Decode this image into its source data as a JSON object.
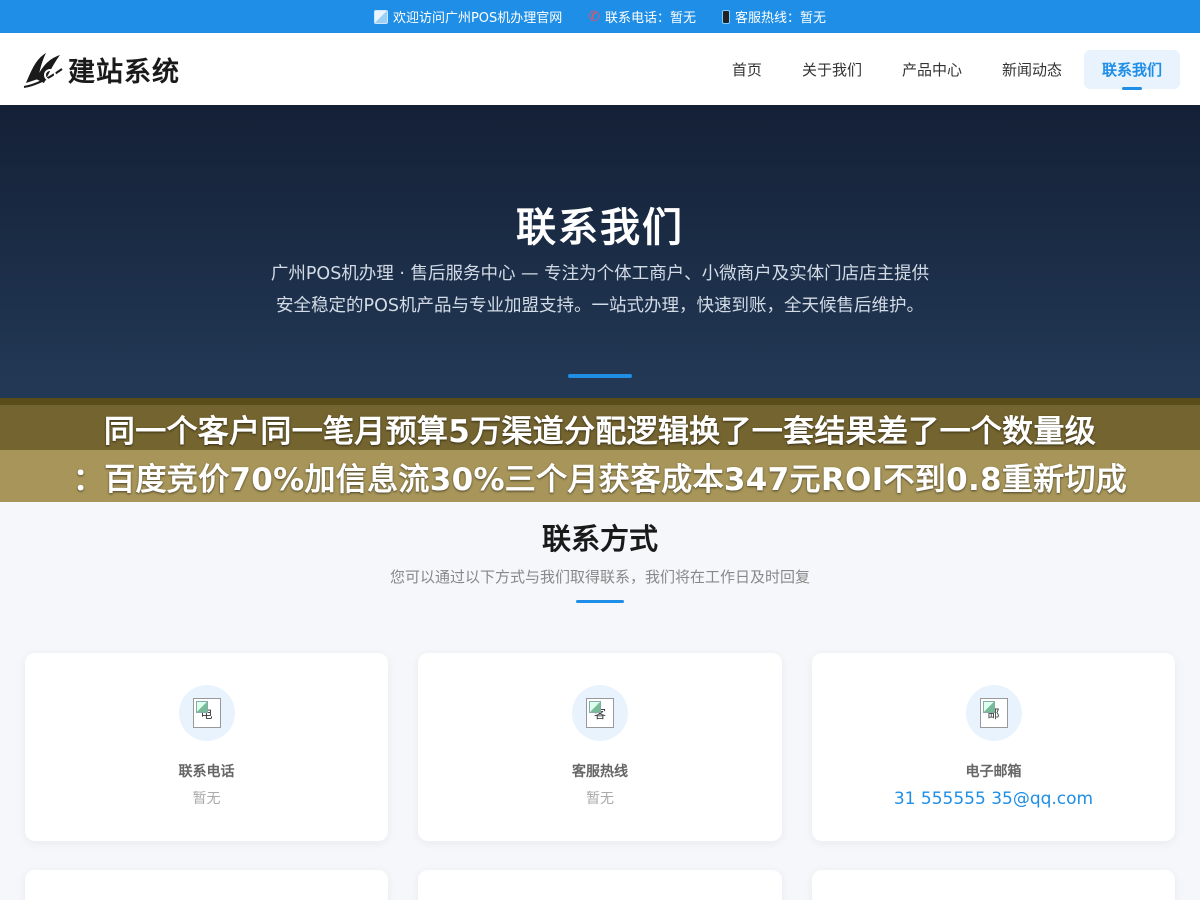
{
  "topbar": {
    "welcome": "欢迎访问广州POS机办理官网",
    "phone": "联系电话：暂无",
    "hotline": "客服热线：暂无"
  },
  "header": {
    "logo_text": "建站系统",
    "nav": [
      {
        "label": "首页"
      },
      {
        "label": "关于我们"
      },
      {
        "label": "产品中心"
      },
      {
        "label": "新闻动态"
      },
      {
        "label": "联系我们",
        "active": true
      }
    ]
  },
  "hero": {
    "title": "联系我们",
    "description": "广州POS机办理 · 售后服务中心 — 专注为个体工商户、小微商户及实体门店店主提供安全稳定的POS机产品与专业加盟支持。一站式办理，快速到账，全天候售后维护。"
  },
  "overlay": {
    "line1": "同一个客户同一笔月预算5万渠道分配逻辑换了一套结果差了一个数量级",
    "line2": "：百度竞价70%加信息流30%三个月获客成本347元ROI不到0.8重新切成"
  },
  "contact": {
    "title": "联系方式",
    "subtitle": "您可以通过以下方式与我们取得联系，我们将在工作日及时回复",
    "cards": [
      {
        "icon_alt": "电",
        "label": "联系电话",
        "value": "暂无"
      },
      {
        "icon_alt": "客",
        "label": "客服热线",
        "value": "暂无"
      },
      {
        "icon_alt": "邮",
        "label": "电子邮箱",
        "value": "31 555555 35@qq.com"
      }
    ]
  },
  "colors": {
    "accent": "#1f8ee6",
    "hero_bg": "#1c2e48",
    "overlay_top": "#625012",
    "overlay_bottom": "#a08c4b"
  }
}
